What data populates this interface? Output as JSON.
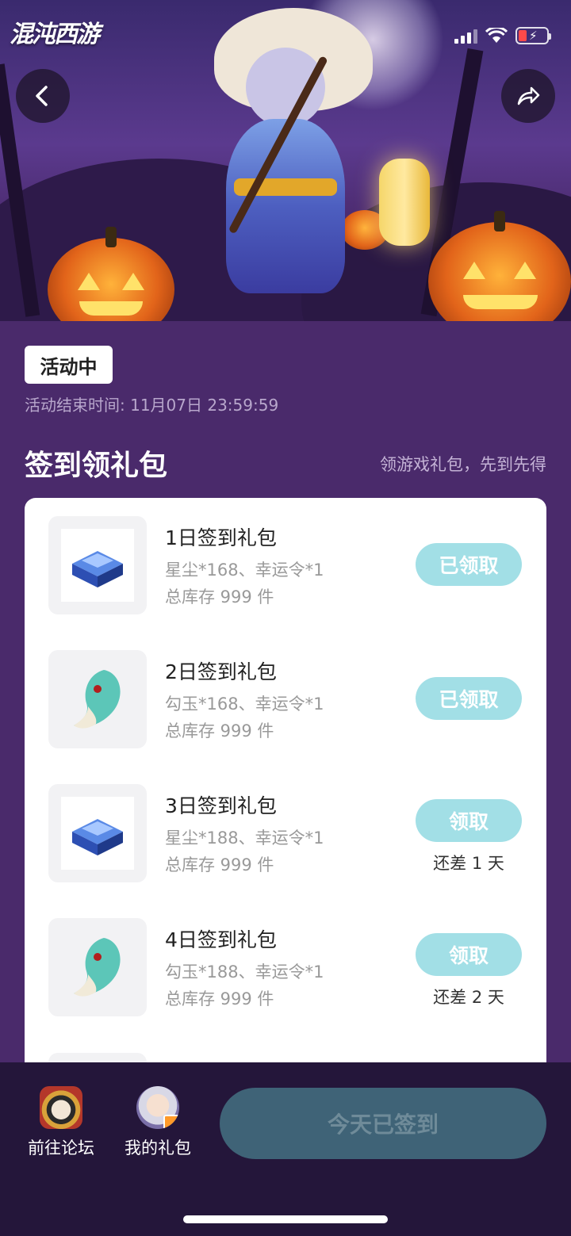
{
  "app": {
    "logo_text": "混沌西游"
  },
  "activity": {
    "status_chip": "活动中",
    "end_time": "活动结束时间: 11月07日 23:59:59"
  },
  "section": {
    "title": "签到领礼包",
    "subtitle": "领游戏礼包，先到先得"
  },
  "gifts": [
    {
      "name": "1日签到礼包",
      "desc": "星尘*168、幸运令*1",
      "stock": "总库存 999 件",
      "button": "已领取",
      "icon": "crystal-chest-icon"
    },
    {
      "name": "2日签到礼包",
      "desc": "勾玉*168、幸运令*1",
      "stock": "总库存 999 件",
      "button": "已领取",
      "icon": "jade-magatama-icon"
    },
    {
      "name": "3日签到礼包",
      "desc": "星尘*188、幸运令*1",
      "stock": "总库存 999 件",
      "button": "领取",
      "remain": "还差 1 天",
      "icon": "crystal-chest-icon"
    },
    {
      "name": "4日签到礼包",
      "desc": "勾玉*188、幸运令*1",
      "stock": "总库存 999 件",
      "button": "领取",
      "remain": "还差 2 天",
      "icon": "jade-magatama-icon"
    }
  ],
  "bottom_bar": {
    "forum_label": "前往论坛",
    "my_gifts_label": "我的礼包",
    "signin_button": "今天已签到"
  },
  "colors": {
    "page_bg": "#4a2a6b",
    "claim_button": "#a2dfe6",
    "signed_button_bg": "#3f6377",
    "bottom_bar": "#24163a"
  },
  "icons": {
    "back": "chevron-left-icon",
    "share": "share-arrow-icon"
  }
}
